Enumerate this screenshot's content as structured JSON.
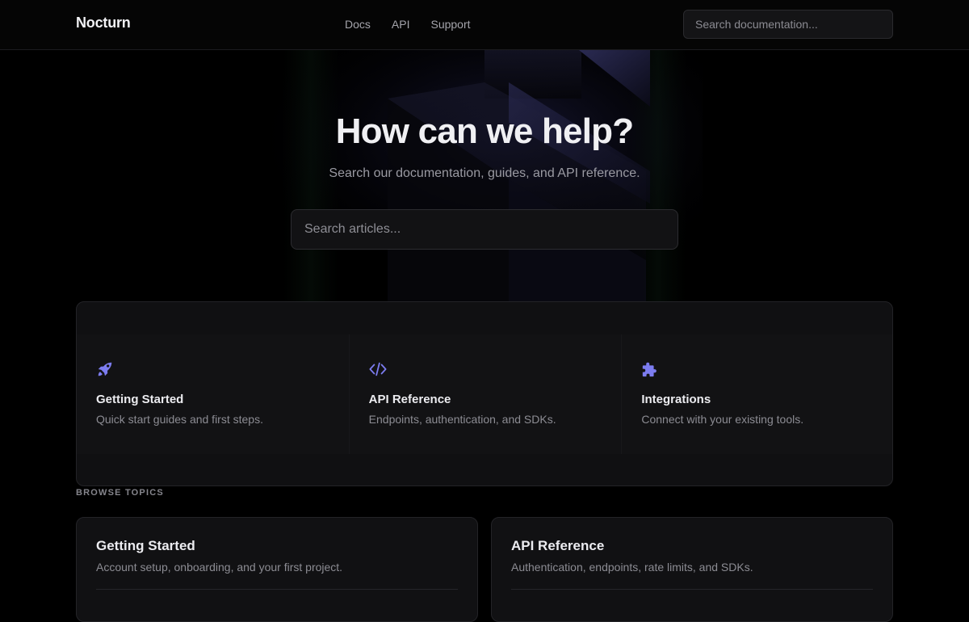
{
  "header": {
    "brand": "Nocturn",
    "nav": [
      "Docs",
      "API",
      "Support"
    ],
    "search_placeholder": "Search documentation..."
  },
  "hero": {
    "title": "How can we help?",
    "subtitle": "Search our documentation, guides, and API reference.",
    "search_placeholder": "Search articles..."
  },
  "quick_links": [
    {
      "icon": "rocket-icon",
      "title": "Getting Started",
      "desc": "Quick start guides and first steps."
    },
    {
      "icon": "code-icon",
      "title": "API Reference",
      "desc": "Endpoints, authentication, and SDKs."
    },
    {
      "icon": "puzzle-icon",
      "title": "Integrations",
      "desc": "Connect with your existing tools."
    }
  ],
  "browse": {
    "label": "BROWSE TOPICS",
    "topics": [
      {
        "title": "Getting Started",
        "desc": "Account setup, onboarding, and your first project."
      },
      {
        "title": "API Reference",
        "desc": "Authentication, endpoints, rate limits, and SDKs."
      }
    ]
  },
  "colors": {
    "accent": "#7c7cf0",
    "background": "#000000",
    "card": "#121214"
  }
}
